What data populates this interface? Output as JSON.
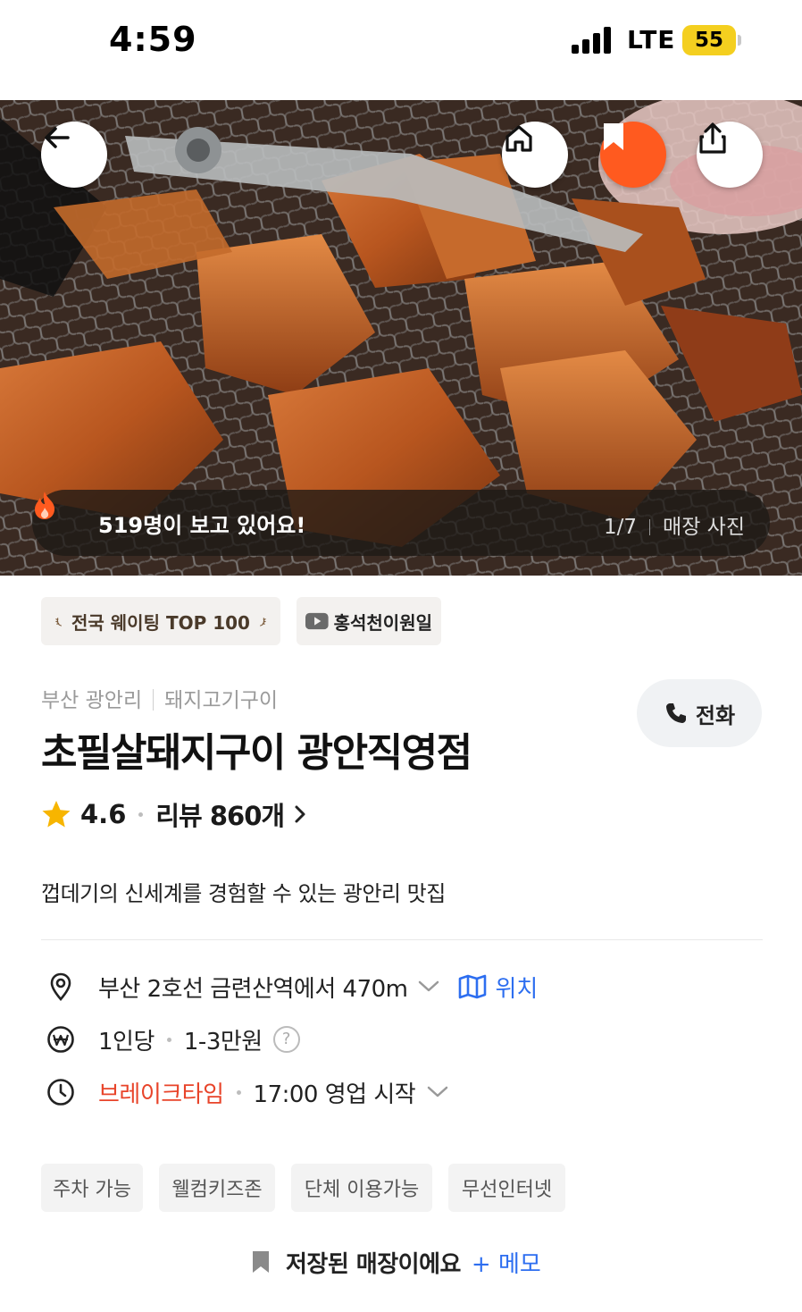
{
  "status_bar": {
    "time": "4:59",
    "network": "LTE",
    "battery": "55"
  },
  "hero": {
    "viewers_text": "519명이 보고 있어요!",
    "photo_index": "1/7",
    "photo_label": "매장 사진"
  },
  "badges": [
    {
      "label": "전국 웨이팅 TOP 100"
    },
    {
      "label": "홍석천이원일"
    }
  ],
  "store": {
    "region": "부산 광안리",
    "category": "돼지고기구이",
    "call_label": "전화",
    "name": "초필살돼지구이 광안직영점",
    "rating": "4.6",
    "reviews": "리뷰 860개",
    "description": "껍데기의 신세계를 경험할 수 있는 광안리 맛집"
  },
  "info": {
    "location": "부산 2호선 금련산역에서 470m",
    "map_label": "위치",
    "price_unit": "1인당",
    "price_range": "1-3만원",
    "hours_status": "브레이크타임",
    "hours_detail": "17:00 영업 시작"
  },
  "facilities": [
    "주차 가능",
    "웰컴키즈존",
    "단체 이용가능",
    "무선인터넷"
  ],
  "saved": {
    "text": "저장된 매장이에요",
    "memo_label": "+ 메모"
  },
  "colors": {
    "accent_orange": "#ff5a1f",
    "link_blue": "#2d6ef0",
    "break_red": "#e8442a",
    "star_yellow": "#f7b500"
  }
}
